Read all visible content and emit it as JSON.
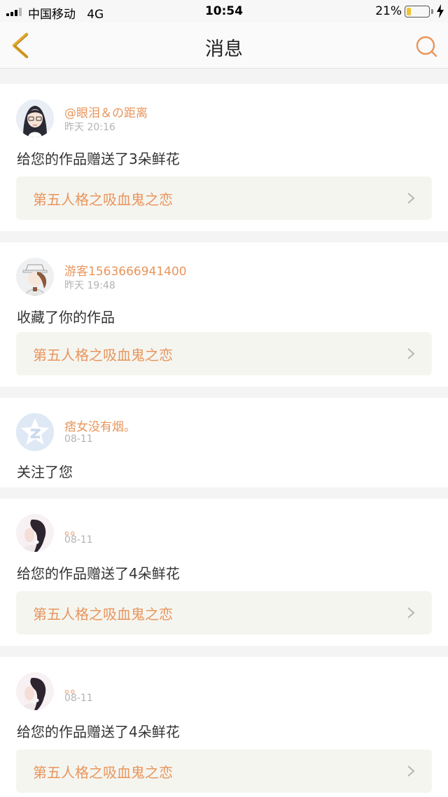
{
  "status_bar": {
    "carrier": "中国移动   4G",
    "time": "10:54",
    "battery_pct": "21%",
    "battery_level": 0.21,
    "battery_color": "#f0c330"
  },
  "nav": {
    "title": "消息",
    "back_icon": "chevron-left-icon",
    "search_icon": "search-icon",
    "accent_color": "#e8955c"
  },
  "messages": [
    {
      "user": "@眼泪＆の距离",
      "time": "昨天 20:16",
      "text": "给您的作品赠送了3朵鲜花",
      "work": "第五人格之吸血鬼之恋"
    },
    {
      "user": "游客1563666941400",
      "time": "昨天 19:48",
      "text": "收藏了你的作品",
      "work": "第五人格之吸血鬼之恋"
    },
    {
      "user": "痞女没有烟。",
      "time": "08-11",
      "text": "关注了您",
      "work": ""
    },
    {
      "user": "。。",
      "time": "08-11",
      "text": "给您的作品赠送了4朵鲜花",
      "work": "第五人格之吸血鬼之恋"
    },
    {
      "user": "。。",
      "time": "08-11",
      "text": "给您的作品赠送了4朵鲜花",
      "work": "第五人格之吸血鬼之恋"
    }
  ]
}
